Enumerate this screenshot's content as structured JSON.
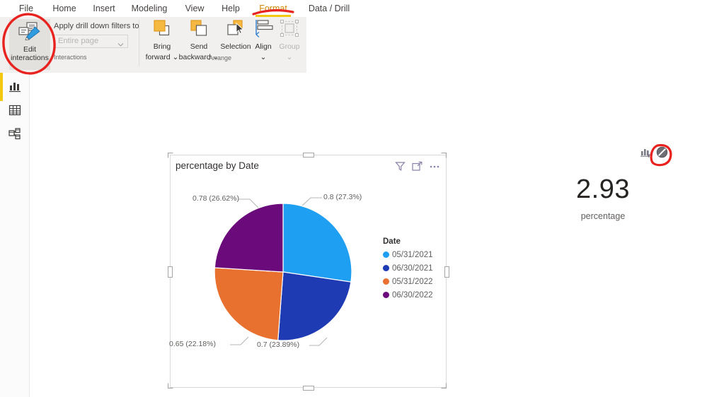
{
  "app": {
    "name": "Power BI Desktop",
    "accent_yellow": "#f2c811",
    "annotation_color": "#e8231f"
  },
  "ribbon": {
    "tabs": [
      {
        "label": "File",
        "active": false
      },
      {
        "label": "Home",
        "active": false
      },
      {
        "label": "Insert",
        "active": false
      },
      {
        "label": "Modeling",
        "active": false
      },
      {
        "label": "View",
        "active": false
      },
      {
        "label": "Help",
        "active": false
      },
      {
        "label": "Format",
        "active": true
      },
      {
        "label": "Data / Drill",
        "active": false
      }
    ],
    "groups": [
      {
        "name": "Interactions",
        "label": "Interactions"
      },
      {
        "name": "Arrange",
        "label": "Arrange"
      }
    ],
    "interactions": {
      "edit_interactions_label_line1": "Edit",
      "edit_interactions_label_line2": "interactions",
      "edit_interactions_icon": "edit-interactions-icon",
      "edit_interactions_pressed": true,
      "drill_filters_label": "Apply drill down filters to",
      "drill_filters_value": "Entire page",
      "drill_filters_placeholder": "Entire page",
      "drill_filters_chevron": "chevron-down-icon"
    },
    "arrange": {
      "bring_forward_line1": "Bring",
      "bring_forward_line2": "forward",
      "bring_forward_icon": "bring-forward-icon",
      "send_backward_line1": "Send",
      "send_backward_line2": "backward",
      "send_backward_icon": "send-backward-icon",
      "selection_label": "Selection",
      "selection_icon": "selection-pane-icon",
      "align_label": "Align",
      "align_icon": "align-icon",
      "group_label": "Group",
      "group_icon": "group-icon",
      "group_disabled": true
    }
  },
  "leftnav": {
    "items": [
      {
        "name": "report-view",
        "icon": "report-bar-chart-icon",
        "selected": true
      },
      {
        "name": "data-view",
        "icon": "data-table-icon",
        "selected": false
      },
      {
        "name": "model-view",
        "icon": "model-relationships-icon",
        "selected": false
      }
    ]
  },
  "pie_visual": {
    "title": "percentage by Date",
    "header_icons": [
      {
        "name": "filter-icon",
        "glyph": "funnel"
      },
      {
        "name": "focus-mode-icon",
        "glyph": "expand"
      },
      {
        "name": "more-options-icon",
        "glyph": "ellipsis"
      }
    ],
    "selected": true
  },
  "card_visual": {
    "value": "2.93",
    "label": "percentage",
    "icons": [
      {
        "name": "filter-applied-icon",
        "glyph": "chart-filter"
      },
      {
        "name": "no-interaction-icon",
        "glyph": "blocked",
        "circled": true
      }
    ]
  },
  "chart_data": {
    "type": "pie",
    "title": "percentage by Date",
    "legend_title": "Date",
    "legend_position": "right",
    "categories": [
      "05/31/2021",
      "06/30/2021",
      "05/31/2022",
      "06/30/2022"
    ],
    "values": [
      0.8,
      0.7,
      0.65,
      0.78
    ],
    "percentages": [
      27.3,
      23.89,
      22.18,
      26.62
    ],
    "colors": [
      "#1e9ff2",
      "#1f3bb3",
      "#e8712f",
      "#6b0a7a"
    ],
    "data_labels": [
      "0.8 (27.3%)",
      "0.7 (23.89%)",
      "0.65 (22.18%)",
      "0.78 (26.62%)"
    ],
    "total": 2.93,
    "xlabel": "",
    "ylabel": ""
  }
}
